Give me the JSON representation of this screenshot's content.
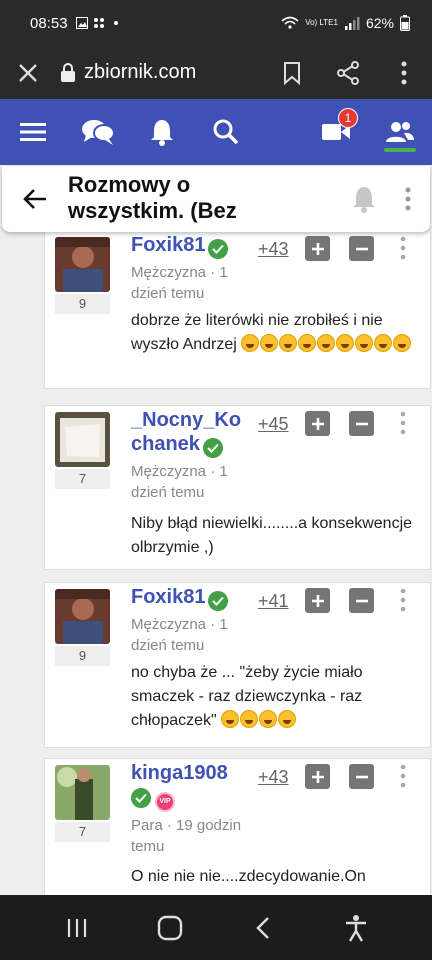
{
  "status_bar": {
    "time": "08:53",
    "network": "Vo) LTE1",
    "battery": "62%"
  },
  "browser": {
    "url": "zbiornik.com",
    "icons": [
      "close-icon",
      "lock-icon",
      "bookmark-icon",
      "share-icon",
      "more-vertical-icon"
    ]
  },
  "site_nav": {
    "video_badge": "1",
    "icons": [
      "menu-icon",
      "chat-icon",
      "bell-icon",
      "search-icon",
      "video-icon",
      "people-icon"
    ],
    "active_accent": "#4caf50",
    "brand_color": "#3f51b5"
  },
  "thread": {
    "title": "Rozmowy o wszystkim. (Bez"
  },
  "posts": [
    {
      "username": "Foxik81",
      "avatar_count": "9",
      "meta": "Mężczyzna · 1 dzień temu",
      "score": "+43",
      "text": "dobrze że literówki nie zrobiłeś i nie wyszło Andrzej",
      "emoji_count": 9,
      "vip": false
    },
    {
      "username": "_Nocny_Kochanek",
      "avatar_count": "7",
      "meta": "Mężczyzna · 1 dzień temu",
      "score": "+45",
      "text": "Niby błąd niewielki........a konsekwencje olbrzymie ,)",
      "emoji_count": 0,
      "vip": false
    },
    {
      "username": "Foxik81",
      "avatar_count": "9",
      "meta": "Mężczyzna · 1 dzień temu",
      "score": "+41",
      "text": "no chyba że ... \"żeby życie miało smaczek - raz dziewczynka - raz chłopaczek\"",
      "emoji_count": 4,
      "vip": false
    },
    {
      "username": "kinga1908",
      "avatar_count": "7",
      "meta": "Para · 19 godzin temu",
      "score": "+43",
      "text": "O nie nie nie....zdecydowanie.On",
      "emoji_count": 0,
      "vip": true,
      "vip_label": "VIP"
    }
  ]
}
